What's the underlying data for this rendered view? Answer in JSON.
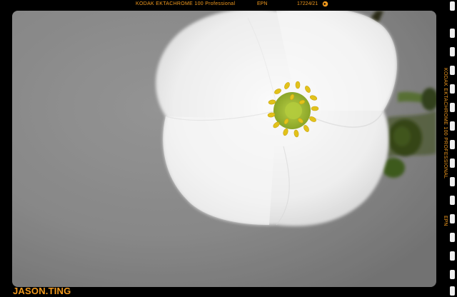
{
  "film_edge": {
    "stock_label": "KODAK EKTACHROME 100 Professional",
    "code": "EPN",
    "frame_number": "17224/21",
    "arrow_icon": "film-advance-arrow-icon",
    "side_stock_label": "KODAK EKTACHROME 100 PROFESSIONAL",
    "side_code": "EPN"
  },
  "signature": "JASON.TING",
  "colors": {
    "film_text": "#f29a1e",
    "background": "#8e8e8e",
    "petal": "#f4f4f4",
    "stamen": "#e2c21a",
    "center": "#a9c438",
    "stem": "#3b4a1e"
  }
}
